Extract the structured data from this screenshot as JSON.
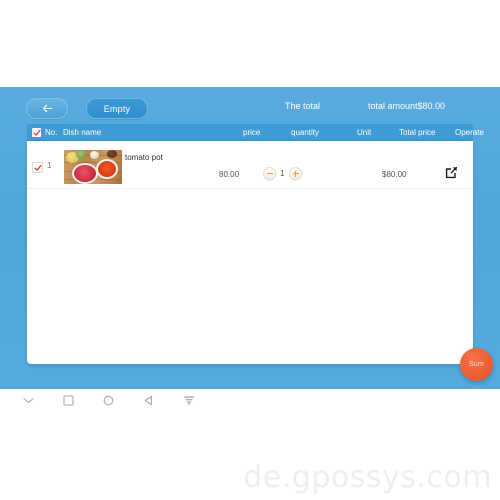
{
  "theme": {
    "panel_blue": "#54a8dd",
    "header_blue": "#3f9bd4",
    "accent_orange": "#ef6034",
    "stepper_orange": "#f0963c",
    "row_red": "#d9534f",
    "white": "#ffffff"
  },
  "toolbar": {
    "back_icon": "arrow-left-icon",
    "empty_label": "Empty",
    "the_total_label": "The total",
    "total_amount_label": "total amount$80.00"
  },
  "table": {
    "select_all_checked": true,
    "columns": [
      {
        "key": "no",
        "label": "No."
      },
      {
        "key": "dish_name",
        "label": "Dish name"
      },
      {
        "key": "price",
        "label": "price"
      },
      {
        "key": "quantity",
        "label": "quantity"
      },
      {
        "key": "unit",
        "label": "Unit"
      },
      {
        "key": "total_price",
        "label": "Total price"
      },
      {
        "key": "operate",
        "label": "Operate"
      }
    ],
    "rows": [
      {
        "checked": true,
        "no": "1",
        "dish_name": "tomato pot",
        "thumbnail": "tomato-pot-photo",
        "price": "80.00",
        "quantity": "1",
        "unit": "",
        "total_price": "$80.00",
        "operate_icon": "edit-icon"
      }
    ]
  },
  "fab": {
    "label": "Sum",
    "name": "sum-button"
  },
  "nav_bar": {
    "items": [
      {
        "icon": "chevron-down-icon"
      },
      {
        "icon": "square-icon"
      },
      {
        "icon": "circle-icon"
      },
      {
        "icon": "triangle-back-icon"
      },
      {
        "icon": "keyboard-hide-icon"
      }
    ]
  },
  "watermark": {
    "text": "de.gpossys.com"
  }
}
